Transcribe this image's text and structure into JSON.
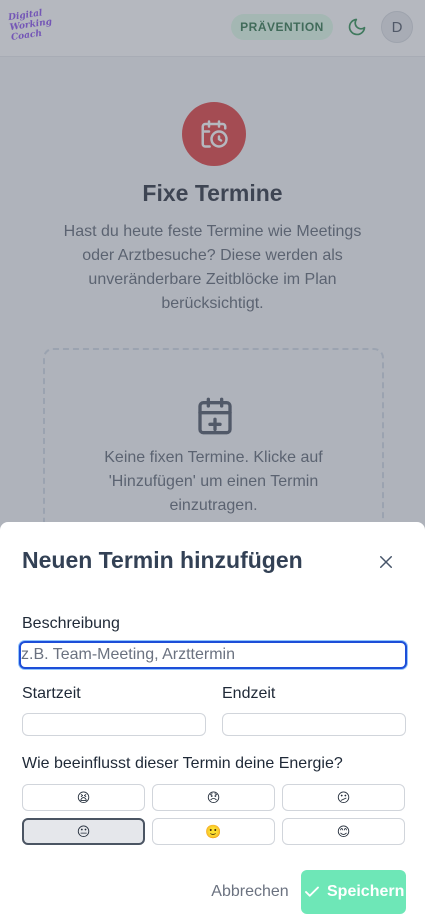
{
  "header": {
    "logo_lines": [
      "Digital",
      "Working",
      "Coach"
    ],
    "badge": "PRÄVENTION",
    "theme_icon": "moon-icon",
    "avatar_initial": "D"
  },
  "page": {
    "title": "Fixe Termine",
    "description": "Hast du heute feste Termine wie Meetings oder Arztbesuche? Diese werden als unveränderbare Zeitblöcke im Plan berücksichtigt.",
    "hero_icon": "calendar-clock-icon",
    "empty_state_icon": "calendar-plus-icon",
    "empty_state_text": "Keine fixen Termine. Klicke auf 'Hinzufügen' um einen Termin einzutragen."
  },
  "modal": {
    "title": "Neuen Termin hinzufügen",
    "close_icon": "close-icon",
    "description_label": "Beschreibung",
    "description_placeholder": "z.B. Team-Meeting, Arzttermin",
    "description_value": "",
    "start_label": "Startzeit",
    "start_value": "",
    "end_label": "Endzeit",
    "end_value": "",
    "energy_question": "Wie beeinflusst dieser Termin deine Energie?",
    "energy_options": [
      {
        "emoji": "😫",
        "icon": "exhausted-face-icon",
        "selected": false
      },
      {
        "emoji": "😞",
        "icon": "disappointed-face-icon",
        "selected": false
      },
      {
        "emoji": "😕",
        "icon": "confused-face-icon",
        "selected": false
      },
      {
        "emoji": "😐",
        "icon": "neutral-face-icon",
        "selected": true
      },
      {
        "emoji": "🙂",
        "icon": "slightly-smiling-face-icon",
        "selected": false
      },
      {
        "emoji": "😊",
        "icon": "smiling-face-icon",
        "selected": false
      }
    ],
    "cancel_label": "Abbrechen",
    "save_label": "Speichern"
  },
  "colors": {
    "accent_red": "#dc2626",
    "badge_bg": "#dcfce7",
    "badge_text": "#166534",
    "save_button": "#6ee7b7",
    "focus_ring": "#1d4ed8"
  }
}
